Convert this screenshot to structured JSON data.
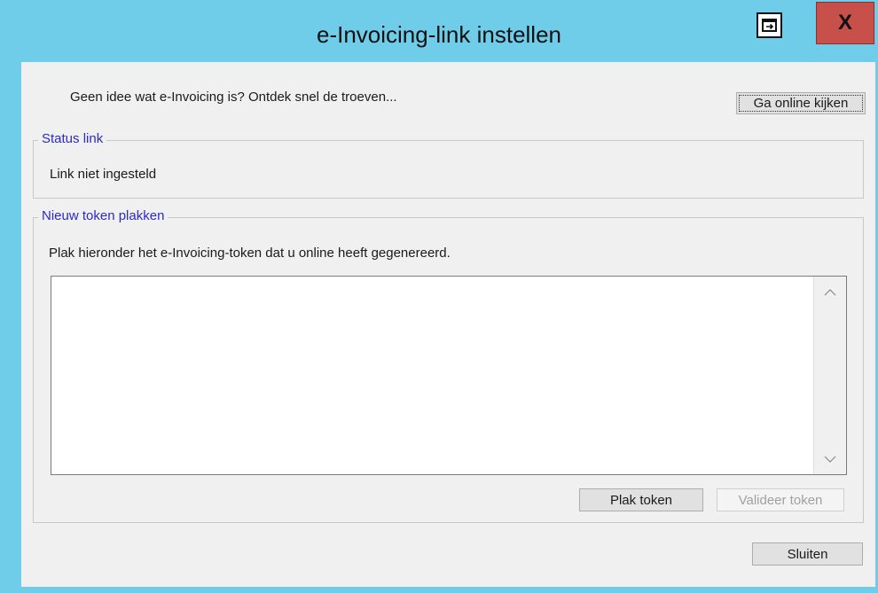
{
  "window": {
    "title": "e-Invoicing-link instellen"
  },
  "titlebar": {
    "restore_icon": "restore-icon",
    "close_label": "X"
  },
  "intro": {
    "text": "Geen idee wat e-Invoicing is? Ontdek snel de troeven...",
    "online_button_label": "Ga online kijken"
  },
  "status_group": {
    "legend": "Status link",
    "status_text": "Link niet ingesteld"
  },
  "token_group": {
    "legend": "Nieuw token plakken",
    "instruction": "Plak hieronder het e-Invoicing-token dat u online heeft gegenereerd.",
    "token_value": "",
    "paste_button_label": "Plak token",
    "validate_button_label": "Valideer token",
    "validate_enabled": false
  },
  "footer": {
    "close_button_label": "Sluiten"
  },
  "colors": {
    "titlebar": "#6fcdea",
    "client": "#f0f0f0",
    "legend_text": "#2b2bc8",
    "close_button": "#c7504a"
  }
}
